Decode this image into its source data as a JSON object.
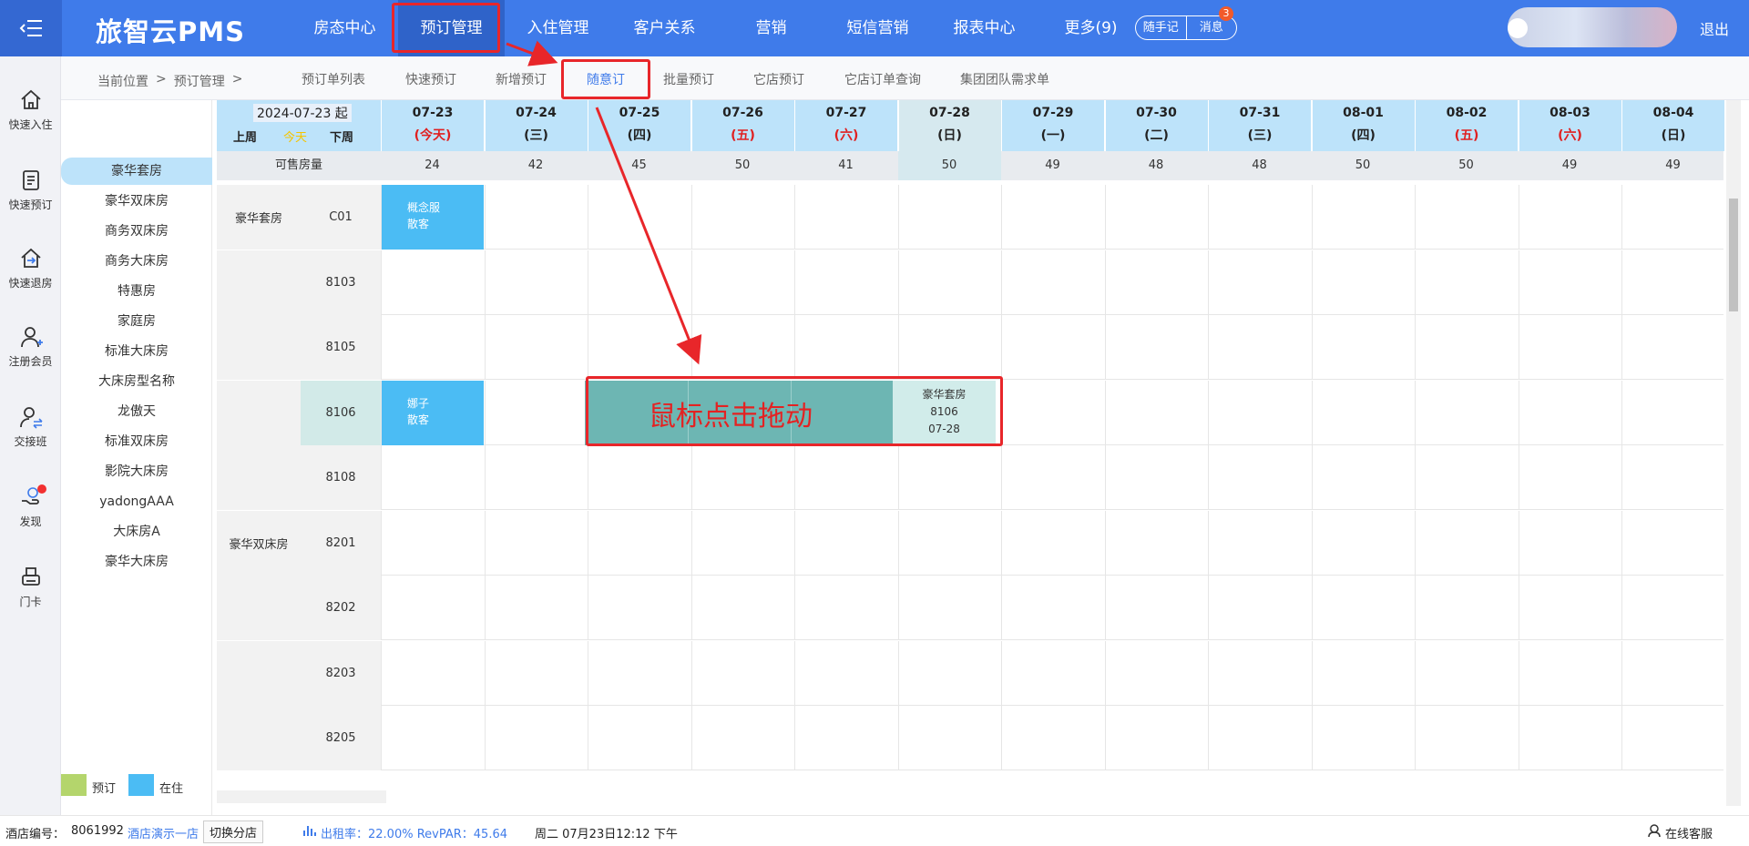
{
  "app": {
    "brand": "旅智云PMS",
    "logout": "退出"
  },
  "nav": [
    {
      "label": "房态中心",
      "active": false
    },
    {
      "label": "预订管理",
      "active": true
    },
    {
      "label": "入住管理",
      "active": false
    },
    {
      "label": "客户关系",
      "active": false
    },
    {
      "label": "营销",
      "active": false
    },
    {
      "label": "短信营销",
      "active": false
    },
    {
      "label": "报表中心",
      "active": false
    },
    {
      "label": "更多(9)",
      "active": false
    }
  ],
  "quick": {
    "notes": "随手记",
    "messages": "消息",
    "message_count": "3"
  },
  "sidebar": [
    {
      "label": "快速入住",
      "icon": "home-icon"
    },
    {
      "label": "快速预订",
      "icon": "document-icon"
    },
    {
      "label": "快速退房",
      "icon": "checkout-icon"
    },
    {
      "label": "注册会员",
      "icon": "add-user-icon"
    },
    {
      "label": "交接班",
      "icon": "shift-swap-icon"
    },
    {
      "label": "发现",
      "icon": "discover-icon"
    },
    {
      "label": "门卡",
      "icon": "card-printer-icon"
    }
  ],
  "breadcrumb": {
    "prefix": "当前位置",
    "sep": ">",
    "current": "预订管理",
    "tail": ">"
  },
  "subnav": [
    {
      "label": "预订单列表",
      "active": false
    },
    {
      "label": "快速预订",
      "active": false
    },
    {
      "label": "新增预订",
      "active": false
    },
    {
      "label": "随意订",
      "active": true
    },
    {
      "label": "批量预订",
      "active": false
    },
    {
      "label": "它店预订",
      "active": false
    },
    {
      "label": "它店订单查询",
      "active": false
    },
    {
      "label": "集团团队需求单",
      "active": false
    }
  ],
  "room_types": [
    "豪华套房",
    "豪华双床房",
    "商务双床房",
    "商务大床房",
    "特惠房",
    "家庭房",
    "标准大床房",
    "大床房型名称",
    "龙傲天",
    "标准双床房",
    "影院大床房",
    "yadongAAA",
    "大床房A",
    "豪华大床房"
  ],
  "legend": {
    "reserved": "预订",
    "reserved_color": "#b4d56c",
    "occupied": "在住",
    "occupied_color": "#4bbcf4"
  },
  "calendar": {
    "start_label": "2024-07-23 起",
    "prev_week": "上周",
    "today": "今天",
    "next_week": "下周",
    "available_label": "可售房量",
    "days": [
      {
        "date": "07-23",
        "week": "(今天)",
        "red": true,
        "avail": "24"
      },
      {
        "date": "07-24",
        "week": "(三)",
        "red": false,
        "avail": "42"
      },
      {
        "date": "07-25",
        "week": "(四)",
        "red": false,
        "avail": "45"
      },
      {
        "date": "07-26",
        "week": "(五)",
        "red": true,
        "avail": "50"
      },
      {
        "date": "07-27",
        "week": "(六)",
        "red": true,
        "avail": "41"
      },
      {
        "date": "07-28",
        "week": "(日)",
        "red": false,
        "avail": "50",
        "sunday": true
      },
      {
        "date": "07-29",
        "week": "(一)",
        "red": false,
        "avail": "49"
      },
      {
        "date": "07-30",
        "week": "(二)",
        "red": false,
        "avail": "48"
      },
      {
        "date": "07-31",
        "week": "(三)",
        "red": false,
        "avail": "48"
      },
      {
        "date": "08-01",
        "week": "(四)",
        "red": false,
        "avail": "50"
      },
      {
        "date": "08-02",
        "week": "(五)",
        "red": true,
        "avail": "50"
      },
      {
        "date": "08-03",
        "week": "(六)",
        "red": true,
        "avail": "49"
      },
      {
        "date": "08-04",
        "week": "(日)",
        "red": false,
        "avail": "49"
      }
    ],
    "rows": [
      {
        "type": "豪华套房",
        "room": "C01",
        "booking": {
          "name": "概念服",
          "kind": "散客"
        }
      },
      {
        "type": "",
        "room": "8103"
      },
      {
        "type": "",
        "room": "8105"
      },
      {
        "type": "",
        "room": "8106",
        "highlight": true,
        "booking": {
          "name": "娜子",
          "kind": "散客"
        }
      },
      {
        "type": "",
        "room": "8108"
      },
      {
        "type": "豪华双床房",
        "room": "8201"
      },
      {
        "type": "",
        "room": "8202"
      },
      {
        "type": "",
        "room": "8203"
      },
      {
        "type": "",
        "room": "8205"
      }
    ],
    "drag": {
      "text": "鼠标点击拖动",
      "tip_type": "豪华套房",
      "tip_room": "8106",
      "tip_date": "07-28"
    }
  },
  "footer": {
    "hotel_label": "酒店编号：",
    "hotel_no": "8061992",
    "hotel_name": "酒店演示一店",
    "switch": "切换分店",
    "occupancy": "出租率：22.00% RevPAR：45.64",
    "datetime": "周二 07月23日12:12 下午",
    "service": "在线客服"
  }
}
